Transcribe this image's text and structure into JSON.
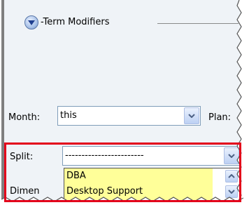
{
  "group": {
    "title": "-Term Modifiers"
  },
  "month": {
    "label": "Month:",
    "value": "this"
  },
  "plan": {
    "label": "Plan:"
  },
  "split": {
    "label": "Split:",
    "value": "------------------------",
    "options": [
      "DBA",
      "Desktop Support"
    ]
  },
  "dimension": {
    "label": "Dimen"
  },
  "colors": {
    "panel_bg": "#eff3f7",
    "field_border": "#7f9db9",
    "dropdown_bg": "#ffff99",
    "highlight": "#e3001b"
  },
  "icons": {
    "collapse": "circle-chevron-down-icon",
    "combo_arrow": "chevron-down-icon",
    "scroll_up": "chevron-up-icon",
    "scroll_down": "chevron-down-icon"
  }
}
